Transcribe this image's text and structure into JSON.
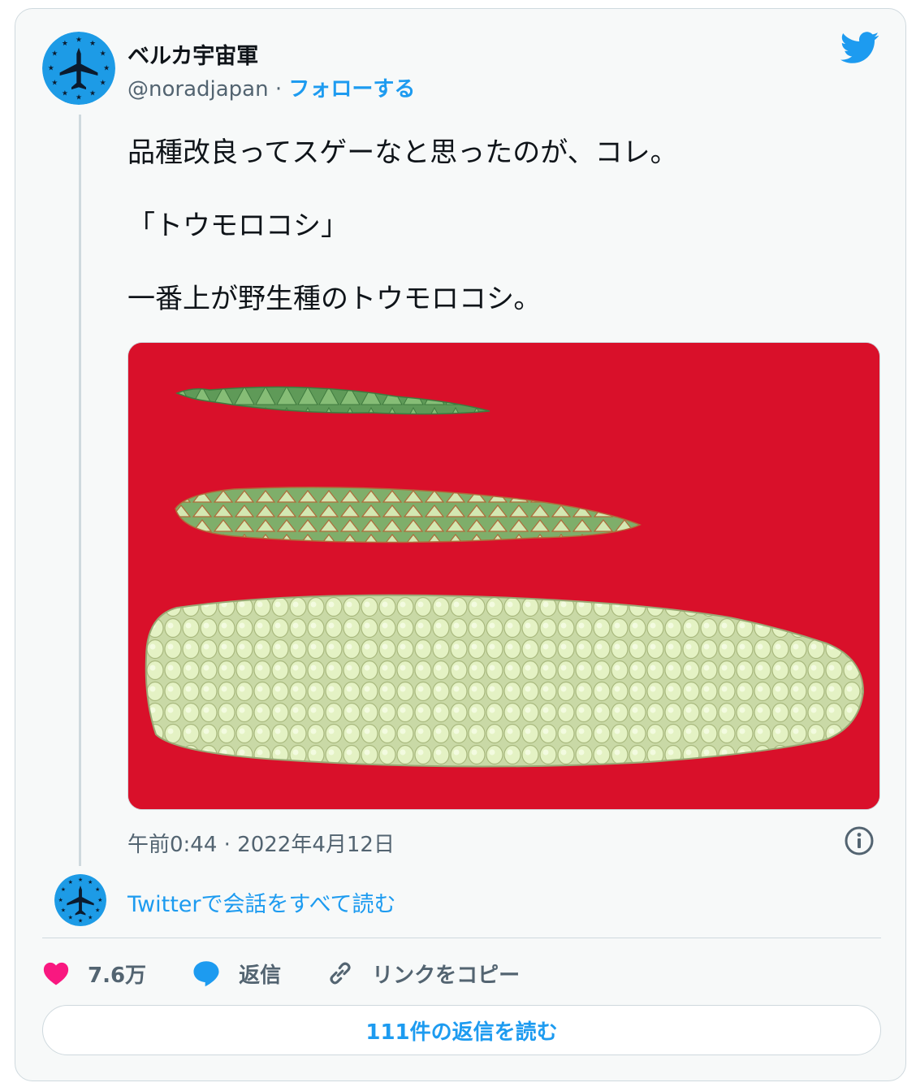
{
  "author": {
    "display_name": "ベルカ宇宙軍",
    "handle": "@noradjapan",
    "separator": " · ",
    "follow_label": "フォローする"
  },
  "tweet": {
    "lines": [
      "品種改良ってスゲーなと思ったのが、コレ。",
      "「トウモロコシ」",
      "一番上が野生種のトウモロコシ。"
    ],
    "timestamp": "午前0:44 · 2022年4月12日"
  },
  "conversation_link": "Twitterで会話をすべて読む",
  "actions": {
    "like_count": "7.6万",
    "reply_label": "返信",
    "copy_link_label": "リンクをコピー"
  },
  "read_replies_label": "111件の返信を読む",
  "colors": {
    "accent": "#1d9bf0",
    "like": "#f91880",
    "media_background": "#d9102a",
    "avatar_background": "#1d9be6"
  },
  "icons": [
    "twitter-bird-icon",
    "info-icon",
    "heart-icon",
    "reply-bubble-icon",
    "link-icon"
  ]
}
